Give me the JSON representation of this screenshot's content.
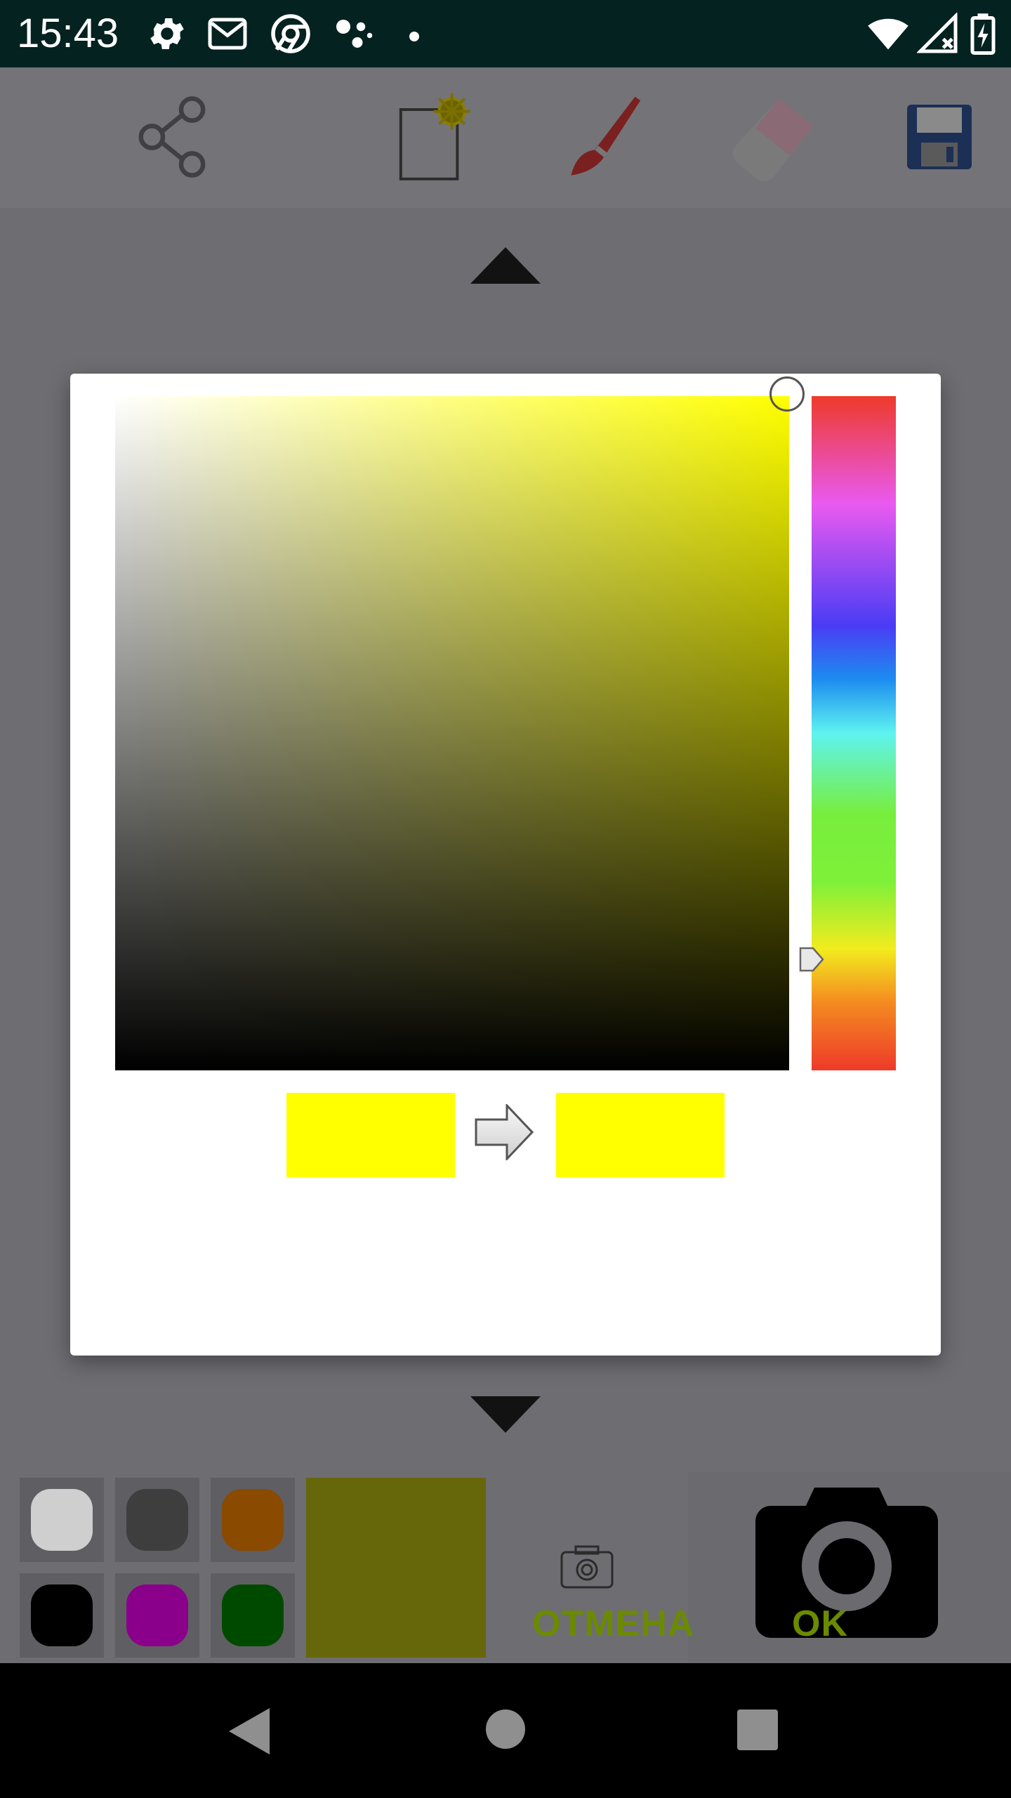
{
  "status_bar": {
    "time": "15:43",
    "icons": [
      "settings-icon",
      "gmail-icon",
      "chrome-icon",
      "assistant-icon",
      "dot-icon",
      "wifi-icon",
      "signal-icon",
      "battery-icon"
    ]
  },
  "toolbar": {
    "tools": [
      "share-icon",
      "new-canvas-icon",
      "brush-icon",
      "eraser-icon",
      "save-icon"
    ]
  },
  "color_picker": {
    "hue": "#ffff00",
    "old_color": "#ffff00",
    "new_color": "#ffff00"
  },
  "dialog": {
    "cancel_label": "ОТМЕНА",
    "ok_label": "OK"
  },
  "palette": {
    "colors": [
      "#cfcfcf",
      "#3e3e3e",
      "#8a4a00",
      "#000000",
      "#8a008a",
      "#004a00"
    ],
    "current_color": "#66660a"
  },
  "colors": {
    "accent": "#6b8a00",
    "status_bar": "#042220",
    "scrim": "#6e6d72"
  }
}
